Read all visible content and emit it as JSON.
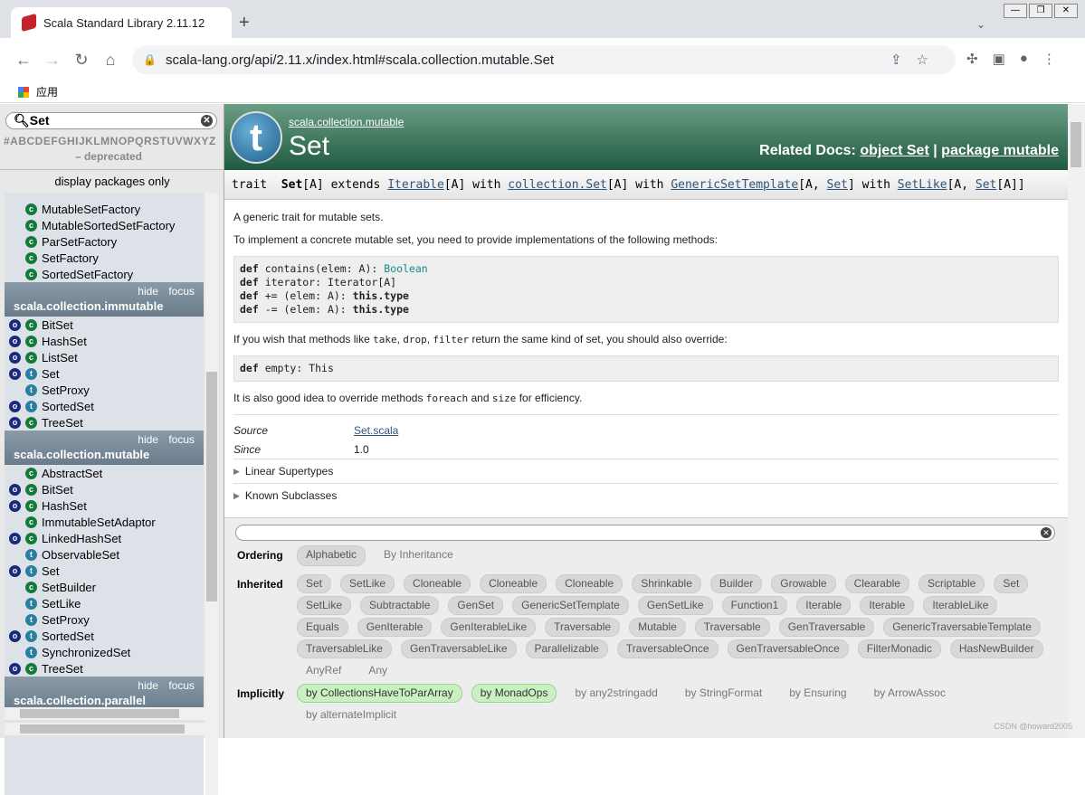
{
  "browser": {
    "tab_title": "Scala Standard Library 2.11.12",
    "url": "scala-lang.org/api/2.11.x/index.html#scala.collection.mutable.Set",
    "bookmark_apps": "应用",
    "new_tab": "+"
  },
  "sidebar": {
    "search_value": "Set",
    "letters": "#ABCDEFGHIJKLMNOPQRSTUVWXYZ",
    "deprecated": "– deprecated",
    "display_packages": "display packages only",
    "hide": "hide",
    "focus": "focus",
    "groups": [
      {
        "package": null,
        "items": [
          {
            "o": false,
            "k": "c",
            "name": "MutableSetFactory"
          },
          {
            "o": false,
            "k": "c",
            "name": "MutableSortedSetFactory"
          },
          {
            "o": false,
            "k": "c",
            "name": "ParSetFactory"
          },
          {
            "o": false,
            "k": "c",
            "name": "SetFactory"
          },
          {
            "o": false,
            "k": "c",
            "name": "SortedSetFactory"
          }
        ]
      },
      {
        "package": "scala.collection.immutable",
        "items": [
          {
            "o": true,
            "k": "c",
            "name": "BitSet"
          },
          {
            "o": true,
            "k": "c",
            "name": "HashSet"
          },
          {
            "o": true,
            "k": "c",
            "name": "ListSet"
          },
          {
            "o": true,
            "k": "t",
            "name": "Set"
          },
          {
            "o": false,
            "k": "t",
            "name": "SetProxy"
          },
          {
            "o": true,
            "k": "t",
            "name": "SortedSet"
          },
          {
            "o": true,
            "k": "c",
            "name": "TreeSet"
          }
        ]
      },
      {
        "package": "scala.collection.mutable",
        "items": [
          {
            "o": false,
            "k": "c",
            "name": "AbstractSet"
          },
          {
            "o": true,
            "k": "c",
            "name": "BitSet"
          },
          {
            "o": true,
            "k": "c",
            "name": "HashSet"
          },
          {
            "o": false,
            "k": "c",
            "name": "ImmutableSetAdaptor"
          },
          {
            "o": true,
            "k": "c",
            "name": "LinkedHashSet"
          },
          {
            "o": false,
            "k": "t",
            "name": "ObservableSet"
          },
          {
            "o": true,
            "k": "t",
            "name": "Set"
          },
          {
            "o": false,
            "k": "c",
            "name": "SetBuilder"
          },
          {
            "o": false,
            "k": "t",
            "name": "SetLike"
          },
          {
            "o": false,
            "k": "t",
            "name": "SetProxy"
          },
          {
            "o": true,
            "k": "t",
            "name": "SortedSet"
          },
          {
            "o": false,
            "k": "t",
            "name": "SynchronizedSet"
          },
          {
            "o": true,
            "k": "c",
            "name": "TreeSet"
          }
        ]
      },
      {
        "package": "scala.collection.parallel",
        "items": []
      }
    ]
  },
  "header": {
    "package_path": "scala.collection.mutable",
    "title": "Set",
    "logo_letter": "t",
    "related_label": "Related Docs:",
    "related_links": [
      "object Set",
      "package mutable"
    ],
    "separator": "|"
  },
  "signature": {
    "kw": "trait",
    "name": "Set",
    "rest": [
      [
        "[A] extends ",
        ""
      ],
      [
        "Iterable",
        ""
      ],
      [
        "[A] with ",
        ""
      ],
      [
        "collection.Set",
        ""
      ],
      [
        "[A] with ",
        ""
      ],
      [
        "GenericSetTemplate",
        ""
      ],
      [
        "[A, ",
        ""
      ],
      [
        "Set",
        ""
      ],
      [
        "] with ",
        ""
      ],
      [
        "SetLike",
        ""
      ],
      [
        "[A, ",
        ""
      ],
      [
        "Set",
        ""
      ],
      [
        "[A]]",
        ""
      ]
    ]
  },
  "comment": {
    "p1": "A generic trait for mutable sets.",
    "p2": "To implement a concrete mutable set, you need to provide implementations of the following methods:",
    "code1": [
      [
        "def",
        " contains(elem: A): ",
        "Boolean",
        ""
      ],
      [
        "def",
        " iterator: Iterator[A]",
        "",
        ""
      ],
      [
        "def",
        " += (elem: A): ",
        "",
        "this.type"
      ],
      [
        "def",
        " -= (elem: A): ",
        "",
        "this.type"
      ]
    ],
    "p3a": "If you wish that methods like ",
    "p3_take": "take",
    "p3_c1": ", ",
    "p3_drop": "drop",
    "p3_c2": ", ",
    "p3_filter": "filter",
    "p3b": " return the same kind of set, you should also override:",
    "code2_kw": "def",
    "code2": " empty: This",
    "p4a": "It is also good idea to override methods ",
    "p4_foreach": "foreach",
    "p4_and": " and ",
    "p4_size": "size",
    "p4b": " for efficiency."
  },
  "attributes": {
    "source_label": "Source",
    "source_value": "Set.scala",
    "since_label": "Since",
    "since_value": "1.0"
  },
  "expanders": [
    "Linear Supertypes",
    "Known Subclasses"
  ],
  "filter": {
    "ordering_label": "Ordering",
    "ordering": [
      {
        "label": "Alphabetic",
        "active": true
      },
      {
        "label": "By Inheritance",
        "active": false
      }
    ],
    "inherited_label": "Inherited",
    "inherited": [
      "Set",
      "SetLike",
      "Cloneable",
      "Cloneable",
      "Cloneable",
      "Shrinkable",
      "Builder",
      "Growable",
      "Clearable",
      "Scriptable",
      "Set",
      "SetLike",
      "Subtractable",
      "GenSet",
      "GenericSetTemplate",
      "GenSetLike",
      "Function1",
      "Iterable",
      "Iterable",
      "IterableLike",
      "Equals",
      "GenIterable",
      "GenIterableLike",
      "Traversable",
      "Mutable",
      "Traversable",
      "GenTraversable",
      "GenericTraversableTemplate",
      "TraversableLike",
      "GenTraversableLike",
      "Parallelizable",
      "TraversableOnce",
      "GenTraversableOnce",
      "FilterMonadic",
      "HasNewBuilder"
    ],
    "inherited_plain": [
      "AnyRef",
      "Any"
    ],
    "implicitly_label": "Implicitly",
    "implicitly": [
      {
        "label": "by CollectionsHaveToParArray",
        "active": true
      },
      {
        "label": "by MonadOps",
        "active": true
      },
      {
        "label": "by any2stringadd",
        "active": false
      },
      {
        "label": "by StringFormat",
        "active": false
      },
      {
        "label": "by Ensuring",
        "active": false
      },
      {
        "label": "by ArrowAssoc",
        "active": false
      },
      {
        "label": "by alternateImplicit",
        "active": false
      }
    ]
  },
  "watermark": "CSDN @howard2005"
}
